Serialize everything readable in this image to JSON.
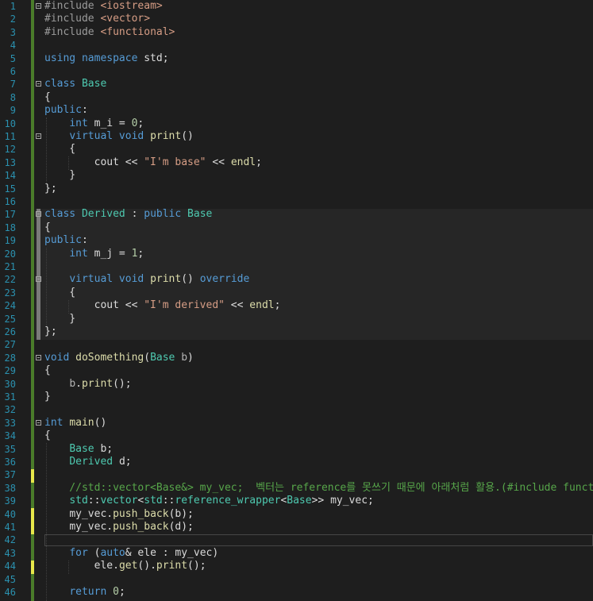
{
  "editor": {
    "colors": {
      "background": "#1e1e1e",
      "line_number": "#2b91af",
      "keyword": "#569cd6",
      "type": "#4ec9b0",
      "string": "#d69d85",
      "comment": "#57a64a",
      "function": "#dcdcaa",
      "changed_saved": "#4a7c2a",
      "changed_unsaved": "#e8e84a"
    },
    "lines": [
      {
        "n": "1",
        "text": "#include <iostream>"
      },
      {
        "n": "2",
        "text": "#include <vector>"
      },
      {
        "n": "3",
        "text": "#include <functional>"
      },
      {
        "n": "4",
        "text": ""
      },
      {
        "n": "5",
        "text": "using namespace std;"
      },
      {
        "n": "6",
        "text": ""
      },
      {
        "n": "7",
        "text": "class Base"
      },
      {
        "n": "8",
        "text": "{"
      },
      {
        "n": "9",
        "text": "public:"
      },
      {
        "n": "10",
        "text": "    int m_i = 0;"
      },
      {
        "n": "11",
        "text": "    virtual void print()"
      },
      {
        "n": "12",
        "text": "    {"
      },
      {
        "n": "13",
        "text": "        cout << \"I'm base\" << endl;"
      },
      {
        "n": "14",
        "text": "    }"
      },
      {
        "n": "15",
        "text": "};"
      },
      {
        "n": "16",
        "text": ""
      },
      {
        "n": "17",
        "text": "class Derived : public Base"
      },
      {
        "n": "18",
        "text": "{"
      },
      {
        "n": "19",
        "text": "public:"
      },
      {
        "n": "20",
        "text": "    int m_j = 1;"
      },
      {
        "n": "21",
        "text": ""
      },
      {
        "n": "22",
        "text": "    virtual void print() override"
      },
      {
        "n": "23",
        "text": "    {"
      },
      {
        "n": "24",
        "text": "        cout << \"I'm derived\" << endl;"
      },
      {
        "n": "25",
        "text": "    }"
      },
      {
        "n": "26",
        "text": "};"
      },
      {
        "n": "27",
        "text": ""
      },
      {
        "n": "28",
        "text": "void doSomething(Base b)"
      },
      {
        "n": "29",
        "text": "{"
      },
      {
        "n": "30",
        "text": "    b.print();"
      },
      {
        "n": "31",
        "text": "}"
      },
      {
        "n": "32",
        "text": ""
      },
      {
        "n": "33",
        "text": "int main()"
      },
      {
        "n": "34",
        "text": "{"
      },
      {
        "n": "35",
        "text": "    Base b;"
      },
      {
        "n": "36",
        "text": "    Derived d;"
      },
      {
        "n": "37",
        "text": ""
      },
      {
        "n": "38",
        "text": "    //std::vector<Base&> my_vec;  벡터는 reference를 못쓰기 때문에 아래처럼 활용.(#include functional)"
      },
      {
        "n": "39",
        "text": "    std::vector<std::reference_wrapper<Base>> my_vec;"
      },
      {
        "n": "40",
        "text": "    my_vec.push_back(b);"
      },
      {
        "n": "41",
        "text": "    my_vec.push_back(d);"
      },
      {
        "n": "42",
        "text": ""
      },
      {
        "n": "43",
        "text": "    for (auto& ele : my_vec)"
      },
      {
        "n": "44",
        "text": "        ele.get().print();"
      },
      {
        "n": "45",
        "text": ""
      },
      {
        "n": "46",
        "text": "    return 0;"
      }
    ]
  }
}
